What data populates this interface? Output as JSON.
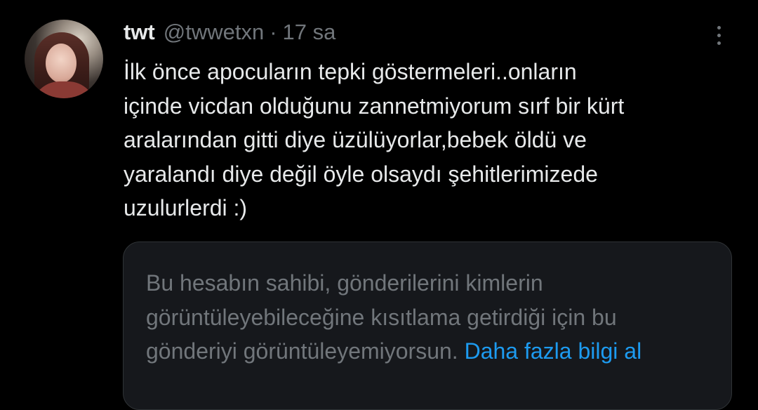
{
  "tweet": {
    "author": {
      "display_name": "twt",
      "handle": "@twwetxn",
      "separator": "·",
      "time": "17 sa"
    },
    "more_icon": "more-vertical-icon",
    "text": "İlk önce apocuların tepki göstermeleri..onların\niçinde vicdan olduğunu zannetmiyorum sırf bir kürt\naralarından gitti diye üzülüyorlar,bebek öldü ve\nyaralandı diye değil öyle olsaydı şehitlerimizede\nuzulurlerdi :)",
    "quoted_notice": {
      "message": "Bu hesabın sahibi, gönderilerini kimlerin görüntüleyebileceğine kısıtlama getirdiği için bu gönderiyi görüntüleyemiyorsun.",
      "learn_more": "Daha fazla bilgi al"
    }
  },
  "colors": {
    "background": "#000000",
    "primary_text": "#e7e9ea",
    "secondary_text": "#71767b",
    "link": "#1d9bf0",
    "card_background": "#16181c",
    "card_border": "#2f3336"
  }
}
